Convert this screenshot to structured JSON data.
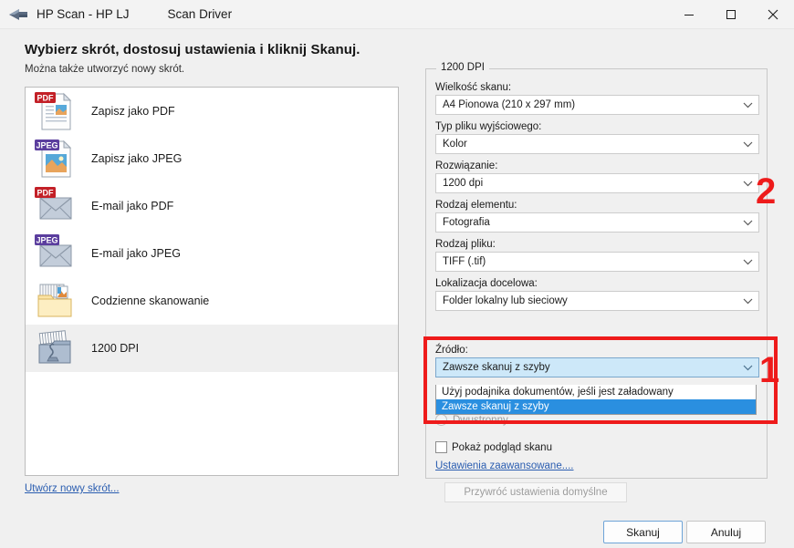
{
  "titlebar": {
    "icon": "scanner-icon",
    "title": "HP Scan - HP LJ",
    "subtitle": "Scan Driver",
    "minimize": "—",
    "maximize": "▢",
    "close": "✕"
  },
  "heading": "Wybierz skrót, dostosuj ustawienia i kliknij Skanuj.",
  "subheading": "Można także utworzyć nowy skrót.",
  "shortcuts": {
    "items": [
      {
        "label": "Zapisz jako PDF",
        "icon": "pdf-document-icon",
        "badge": "PDF",
        "selected": false
      },
      {
        "label": "Zapisz jako JPEG",
        "icon": "jpeg-document-icon",
        "badge": "JPEG",
        "selected": false
      },
      {
        "label": "E-mail jako PDF",
        "icon": "pdf-email-icon",
        "badge": "PDF",
        "selected": false
      },
      {
        "label": "E-mail jako JPEG",
        "icon": "jpeg-email-icon",
        "badge": "JPEG",
        "selected": false
      },
      {
        "label": "Codzienne skanowanie",
        "icon": "folder-scan-icon",
        "badge": "",
        "selected": false
      },
      {
        "label": "1200 DPI",
        "icon": "scanner-photo-icon",
        "badge": "",
        "selected": true
      }
    ],
    "create_link": "Utwórz nowy skrót..."
  },
  "settings": {
    "group_title": "1200 DPI",
    "fields": [
      {
        "label": "Wielkość skanu:",
        "value": "A4 Pionowa (210 x 297 mm)"
      },
      {
        "label": "Typ pliku wyjściowego:",
        "value": "Kolor"
      },
      {
        "label": "Rozwiązanie:",
        "value": "1200 dpi"
      },
      {
        "label": "Rodzaj elementu:",
        "value": "Fotografia"
      },
      {
        "label": "Rodzaj pliku:",
        "value": "TIFF (.tif)"
      },
      {
        "label": "Lokalizacja docelowa:",
        "value": "Folder lokalny lub sieciowy"
      }
    ],
    "source": {
      "label": "Źródło:",
      "value": "Zawsze skanuj z szyby",
      "options": [
        "Użyj podajnika dokumentów, jeśli jest załadowany",
        "Zawsze skanuj z szyby"
      ],
      "selected_index": 1
    },
    "duplex_label": "Dwustronny",
    "preview_label": "Pokaż podgląd skanu",
    "preview_checked": false,
    "advanced_link": "Ustawienia zaawansowane....",
    "restore_defaults": "Przywróć ustawienia domyślne"
  },
  "buttons": {
    "scan": "Skanuj",
    "cancel": "Anuluj"
  },
  "annotations": {
    "marker_one": "1",
    "marker_two": "2",
    "color": "#ee1b1b"
  }
}
